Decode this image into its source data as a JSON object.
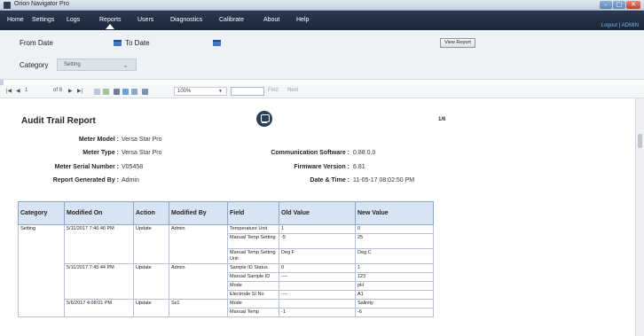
{
  "window": {
    "title": "Orion Navigator Pro"
  },
  "menu": {
    "items": [
      "Home",
      "Settings",
      "Logs",
      "Reports",
      "Users",
      "Diagnostics",
      "Calibrate",
      "About",
      "Help"
    ],
    "active": "Reports",
    "user_links": "Logout | ADMIN"
  },
  "filters": {
    "from_date_label": "From Date",
    "to_date_label": "To Date",
    "category_label": "Category",
    "category_value": "Setting",
    "view_report_label": "View Report"
  },
  "toolbar": {
    "page_first": "|◀",
    "page_prev": "◀",
    "page_current": "1",
    "page_of": "of 8",
    "page_next": "▶",
    "page_last": "▶|",
    "zoom": "100%",
    "find_label": "Find",
    "next_label": "Next"
  },
  "report": {
    "title": "Audit Trail Report",
    "page_count": "1/6",
    "meta_left": [
      {
        "label": "Meter Model :",
        "value": "Versa Star Pro"
      },
      {
        "label": "Meter Type :",
        "value": "Versa Star Pro"
      },
      {
        "label": "Meter Serial Number :",
        "value": "V05458"
      },
      {
        "label": "Report Generated By :",
        "value": "Admin"
      }
    ],
    "meta_right": [
      {
        "label": "Communication Software :",
        "value": "0.88.0.0"
      },
      {
        "label": "Firmware Version :",
        "value": "6.81"
      },
      {
        "label": "Date & Time :",
        "value": "11-05-17 08:02:50 PM"
      }
    ],
    "columns": [
      "Category",
      "Modified On",
      "Action",
      "Modified By",
      "Field",
      "Old Value",
      "New Value"
    ],
    "category": "Setting",
    "groups": [
      {
        "modified_on": "5/11/2017 7:46:46 PM",
        "action": "Update",
        "modified_by": "Admin",
        "rows": [
          {
            "field": "Temperature Unit",
            "old": "1",
            "new": "0",
            "tall": false
          },
          {
            "field": "Manual Temp Setting",
            "old": "-5",
            "new": "25",
            "tall": true
          },
          {
            "field": "Manual Temp Setting Unit",
            "old": "Deg F",
            "new": "Deg C",
            "tall": true
          }
        ]
      },
      {
        "modified_on": "5/11/2017 7:45:44 PM",
        "action": "Update",
        "modified_by": "Admin",
        "rows": [
          {
            "field": "Sample ID Status",
            "old": "0",
            "new": "1",
            "tall": false
          },
          {
            "field": "Manual Sample ID",
            "old": "----",
            "new": "123",
            "tall": false
          },
          {
            "field": "Mode",
            "old": "",
            "new": "pH",
            "tall": false
          },
          {
            "field": "Electrode SI No",
            "old": "----",
            "new": "A1",
            "tall": false
          }
        ]
      },
      {
        "modified_on": "5/6/2017 4:08:01 PM",
        "action": "Update",
        "modified_by": "Ss1",
        "rows": [
          {
            "field": "Mode",
            "old": "",
            "new": "Salinity",
            "tall": false
          },
          {
            "field": "Manual Temp",
            "old": "-1",
            "new": "-6",
            "tall": false
          }
        ]
      }
    ]
  }
}
